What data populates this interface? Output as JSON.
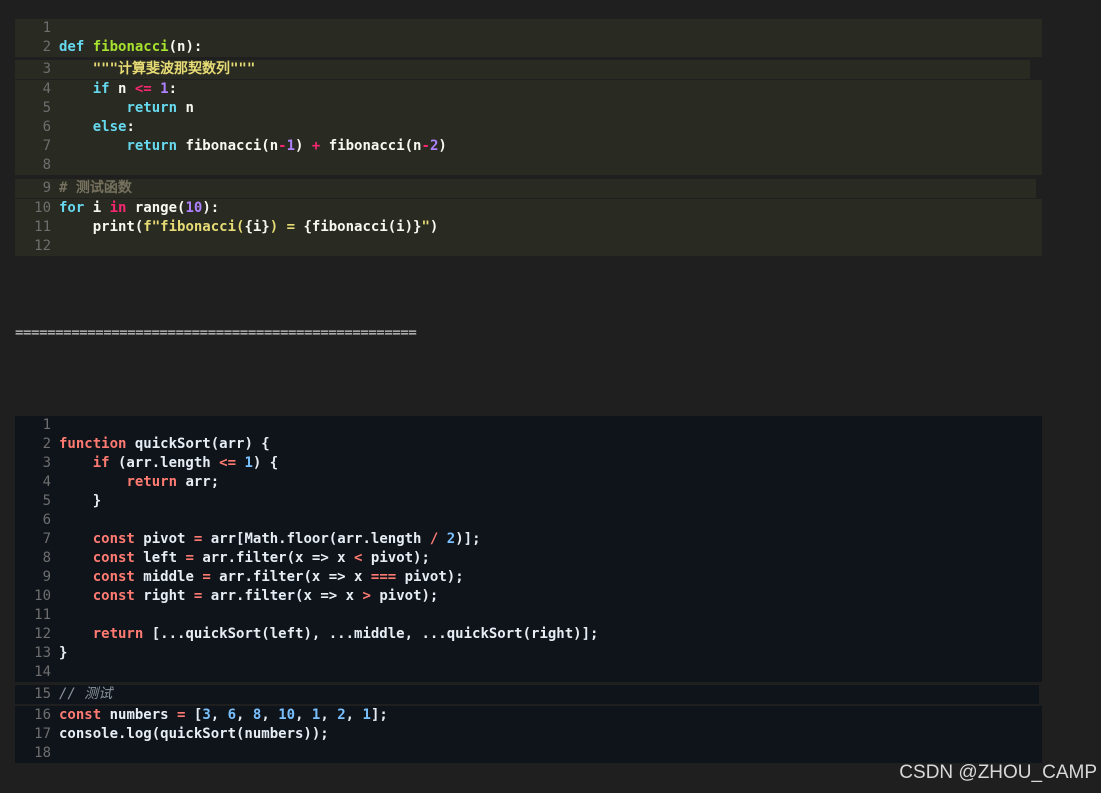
{
  "python_block": {
    "lines": [
      {
        "num": "1",
        "tokens": []
      },
      {
        "num": "2",
        "tokens": [
          {
            "t": "def",
            "c": "kw"
          },
          {
            "t": " ",
            "c": "tx"
          },
          {
            "t": "fibonacci",
            "c": "fn"
          },
          {
            "t": "(n):",
            "c": "tx"
          }
        ]
      },
      {
        "num": "3",
        "tokens": [
          {
            "t": "    ",
            "c": "tx"
          },
          {
            "t": "\"\"\"计算斐波那契数列\"\"\"",
            "c": "str"
          }
        ]
      },
      {
        "num": "4",
        "tokens": [
          {
            "t": "    ",
            "c": "tx"
          },
          {
            "t": "if",
            "c": "kw"
          },
          {
            "t": " n ",
            "c": "tx"
          },
          {
            "t": "<=",
            "c": "op"
          },
          {
            "t": " ",
            "c": "tx"
          },
          {
            "t": "1",
            "c": "num"
          },
          {
            "t": ":",
            "c": "tx"
          }
        ]
      },
      {
        "num": "5",
        "tokens": [
          {
            "t": "        ",
            "c": "tx"
          },
          {
            "t": "return",
            "c": "kw"
          },
          {
            "t": " n",
            "c": "tx"
          }
        ]
      },
      {
        "num": "6",
        "tokens": [
          {
            "t": "    ",
            "c": "tx"
          },
          {
            "t": "else",
            "c": "kw"
          },
          {
            "t": ":",
            "c": "tx"
          }
        ]
      },
      {
        "num": "7",
        "tokens": [
          {
            "t": "        ",
            "c": "tx"
          },
          {
            "t": "return",
            "c": "kw"
          },
          {
            "t": " fibonacci(n",
            "c": "tx"
          },
          {
            "t": "-",
            "c": "op"
          },
          {
            "t": "1",
            "c": "num"
          },
          {
            "t": ") ",
            "c": "tx"
          },
          {
            "t": "+",
            "c": "op"
          },
          {
            "t": " fibonacci(n",
            "c": "tx"
          },
          {
            "t": "-",
            "c": "op"
          },
          {
            "t": "2",
            "c": "num"
          },
          {
            "t": ")",
            "c": "tx"
          }
        ]
      },
      {
        "num": "8",
        "tokens": []
      },
      {
        "num": "9",
        "tokens": [
          {
            "t": "# 测试函数",
            "c": "cm"
          }
        ]
      },
      {
        "num": "10",
        "tokens": [
          {
            "t": "for",
            "c": "kw"
          },
          {
            "t": " i ",
            "c": "tx"
          },
          {
            "t": "in",
            "c": "op"
          },
          {
            "t": " range(",
            "c": "tx"
          },
          {
            "t": "10",
            "c": "num"
          },
          {
            "t": "):",
            "c": "tx"
          }
        ]
      },
      {
        "num": "11",
        "tokens": [
          {
            "t": "    print(",
            "c": "tx"
          },
          {
            "t": "f\"fibonacci(",
            "c": "str"
          },
          {
            "t": "{i}",
            "c": "tx"
          },
          {
            "t": ") = ",
            "c": "str"
          },
          {
            "t": "{fibonacci(i)}",
            "c": "tx"
          },
          {
            "t": "\"",
            "c": "str"
          },
          {
            "t": ")",
            "c": "tx"
          }
        ]
      },
      {
        "num": "12",
        "tokens": []
      }
    ]
  },
  "divider": "==================================================",
  "js_block": {
    "lines": [
      {
        "num": "1",
        "tokens": []
      },
      {
        "num": "2",
        "tokens": [
          {
            "t": "function",
            "c": "kw"
          },
          {
            "t": " quickSort(arr) {",
            "c": "tx"
          }
        ]
      },
      {
        "num": "3",
        "tokens": [
          {
            "t": "    ",
            "c": "tx"
          },
          {
            "t": "if",
            "c": "kw"
          },
          {
            "t": " (arr.length ",
            "c": "tx"
          },
          {
            "t": "<=",
            "c": "op"
          },
          {
            "t": " ",
            "c": "tx"
          },
          {
            "t": "1",
            "c": "num"
          },
          {
            "t": ") {",
            "c": "tx"
          }
        ]
      },
      {
        "num": "4",
        "tokens": [
          {
            "t": "        ",
            "c": "tx"
          },
          {
            "t": "return",
            "c": "kw"
          },
          {
            "t": " arr;",
            "c": "tx"
          }
        ]
      },
      {
        "num": "5",
        "tokens": [
          {
            "t": "    }",
            "c": "tx"
          }
        ]
      },
      {
        "num": "6",
        "tokens": []
      },
      {
        "num": "7",
        "tokens": [
          {
            "t": "    ",
            "c": "tx"
          },
          {
            "t": "const",
            "c": "kw"
          },
          {
            "t": " pivot ",
            "c": "tx"
          },
          {
            "t": "=",
            "c": "op"
          },
          {
            "t": " arr[Math.floor(arr.length ",
            "c": "tx"
          },
          {
            "t": "/",
            "c": "op"
          },
          {
            "t": " ",
            "c": "tx"
          },
          {
            "t": "2",
            "c": "num"
          },
          {
            "t": ")];",
            "c": "tx"
          }
        ]
      },
      {
        "num": "8",
        "tokens": [
          {
            "t": "    ",
            "c": "tx"
          },
          {
            "t": "const",
            "c": "kw"
          },
          {
            "t": " left ",
            "c": "tx"
          },
          {
            "t": "=",
            "c": "op"
          },
          {
            "t": " arr.filter(x => x ",
            "c": "tx"
          },
          {
            "t": "<",
            "c": "op"
          },
          {
            "t": " pivot);",
            "c": "tx"
          }
        ]
      },
      {
        "num": "9",
        "tokens": [
          {
            "t": "    ",
            "c": "tx"
          },
          {
            "t": "const",
            "c": "kw"
          },
          {
            "t": " middle ",
            "c": "tx"
          },
          {
            "t": "=",
            "c": "op"
          },
          {
            "t": " arr.filter(x => x ",
            "c": "tx"
          },
          {
            "t": "===",
            "c": "op"
          },
          {
            "t": " pivot);",
            "c": "tx"
          }
        ]
      },
      {
        "num": "10",
        "tokens": [
          {
            "t": "    ",
            "c": "tx"
          },
          {
            "t": "const",
            "c": "kw"
          },
          {
            "t": " right ",
            "c": "tx"
          },
          {
            "t": "=",
            "c": "op"
          },
          {
            "t": " arr.filter(x => x ",
            "c": "tx"
          },
          {
            "t": ">",
            "c": "op"
          },
          {
            "t": " pivot);",
            "c": "tx"
          }
        ]
      },
      {
        "num": "11",
        "tokens": []
      },
      {
        "num": "12",
        "tokens": [
          {
            "t": "    ",
            "c": "tx"
          },
          {
            "t": "return",
            "c": "kw"
          },
          {
            "t": " [...quickSort(left), ...middle, ...quickSort(right)];",
            "c": "tx"
          }
        ]
      },
      {
        "num": "13",
        "tokens": [
          {
            "t": "}",
            "c": "tx"
          }
        ]
      },
      {
        "num": "14",
        "tokens": []
      },
      {
        "num": "15",
        "tokens": [
          {
            "t": "// 测试",
            "c": "cm"
          }
        ]
      },
      {
        "num": "16",
        "tokens": [
          {
            "t": "const",
            "c": "kw"
          },
          {
            "t": " numbers ",
            "c": "tx"
          },
          {
            "t": "=",
            "c": "op"
          },
          {
            "t": " [",
            "c": "tx"
          },
          {
            "t": "3",
            "c": "num"
          },
          {
            "t": ", ",
            "c": "tx"
          },
          {
            "t": "6",
            "c": "num"
          },
          {
            "t": ", ",
            "c": "tx"
          },
          {
            "t": "8",
            "c": "num"
          },
          {
            "t": ", ",
            "c": "tx"
          },
          {
            "t": "10",
            "c": "num"
          },
          {
            "t": ", ",
            "c": "tx"
          },
          {
            "t": "1",
            "c": "num"
          },
          {
            "t": ", ",
            "c": "tx"
          },
          {
            "t": "2",
            "c": "num"
          },
          {
            "t": ", ",
            "c": "tx"
          },
          {
            "t": "1",
            "c": "num"
          },
          {
            "t": "];",
            "c": "tx"
          }
        ]
      },
      {
        "num": "17",
        "tokens": [
          {
            "t": "console.log(quickSort(numbers));",
            "c": "tx"
          }
        ]
      },
      {
        "num": "18",
        "tokens": []
      }
    ]
  },
  "watermark": "CSDN @ZHOU_CAMP",
  "colors": {
    "page_bg": "#1f1f1f",
    "python_bg": "#292a22",
    "js_bg": "#0f141b"
  }
}
